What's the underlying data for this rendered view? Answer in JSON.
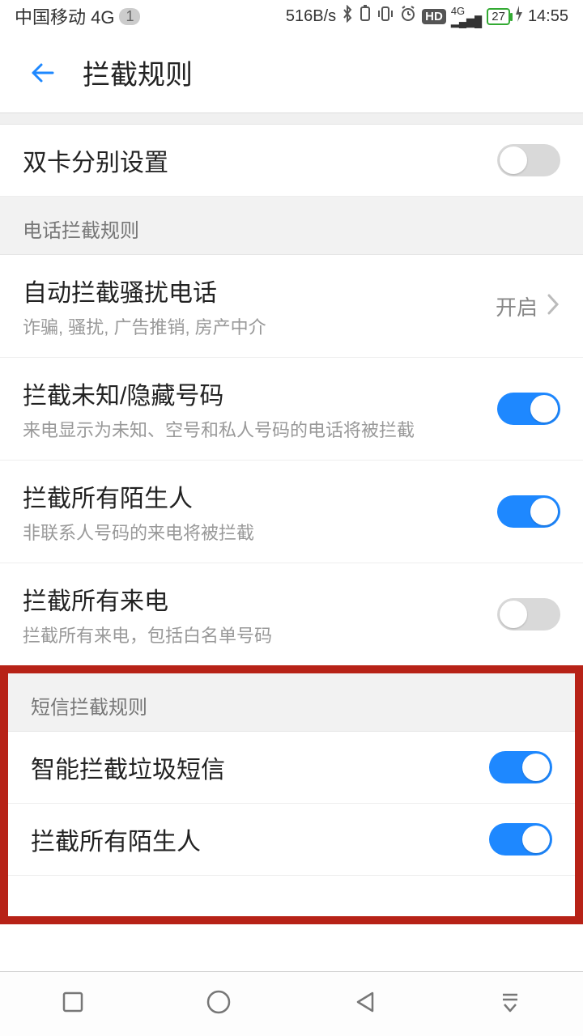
{
  "status": {
    "carrier": "中国移动 4G",
    "sim_slot": "1",
    "net_speed": "516B/s",
    "battery_pct": "27",
    "time": "14:55"
  },
  "header": {
    "title": "拦截规则"
  },
  "rows": {
    "dual_sim": {
      "title": "双卡分别设置"
    },
    "section_phone": "电话拦截规则",
    "auto_block": {
      "title": "自动拦截骚扰电话",
      "subtitle": "诈骗, 骚扰, 广告推销, 房产中介",
      "value": "开启"
    },
    "block_unknown": {
      "title": "拦截未知/隐藏号码",
      "subtitle": "来电显示为未知、空号和私人号码的电话将被拦截"
    },
    "block_strangers_call": {
      "title": "拦截所有陌生人",
      "subtitle": "非联系人号码的来电将被拦截"
    },
    "block_all_calls": {
      "title": "拦截所有来电",
      "subtitle": "拦截所有来电，包括白名单号码"
    },
    "section_sms": "短信拦截规则",
    "smart_block_sms": {
      "title": "智能拦截垃圾短信"
    },
    "block_strangers_sms": {
      "title": "拦截所有陌生人"
    }
  }
}
